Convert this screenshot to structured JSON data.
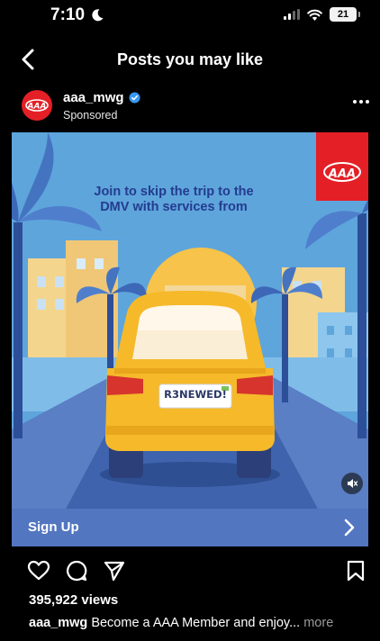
{
  "status_bar": {
    "time": "7:10",
    "battery": "21"
  },
  "nav": {
    "title": "Posts you may like"
  },
  "post": {
    "username": "aaa_mwg",
    "sponsored_label": "Sponsored",
    "ad": {
      "headline": "Join to skip the trip to the DMV with services from",
      "plate": "R3NEWED!",
      "brand_color": "#e41f26"
    },
    "cta": {
      "label": "Sign Up"
    },
    "views": "395,922 views",
    "caption": {
      "user": "aaa_mwg",
      "text": " Become a AAA Member and enjoy...",
      "more": " more"
    }
  },
  "icons": [
    "moon-icon",
    "signal-icon",
    "wifi-icon",
    "battery-icon",
    "back-icon",
    "verified-icon",
    "more-icon",
    "mute-icon",
    "chevron-right-icon",
    "heart-icon",
    "comment-icon",
    "share-icon",
    "bookmark-icon"
  ]
}
